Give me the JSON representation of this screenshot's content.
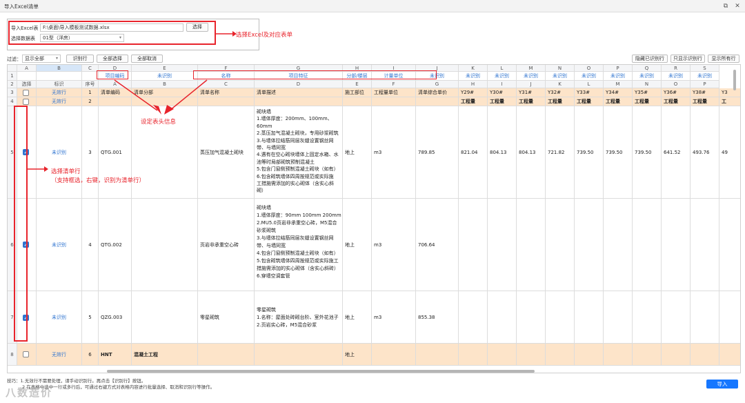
{
  "window": {
    "title": "导入Excel清单"
  },
  "file_panel": {
    "excel_label": "导入Excel表",
    "excel_path": "F:\\桌面\\导入模板测试数据.xlsx",
    "select_button": "选择",
    "sheet_label": "选择数据表",
    "sheet_value": "01型（洋房）"
  },
  "annotations": {
    "file_note": "选择Excel及对应表单",
    "header_note": "设定表头信息",
    "row_note_1": "选择清单行",
    "row_note_2": "（支持框选，右键，识别为清单行）"
  },
  "toolbar": {
    "filter_label": "过滤：",
    "filter_value": "显示全部",
    "btn_identify": "识别行",
    "btn_select_all": "全部选择",
    "btn_deselect_all": "全部取消",
    "btn_hide_identified": "隐藏已识别行",
    "btn_show_identified_only": "只显示识别行",
    "btn_show_all": "显示所有行"
  },
  "grid": {
    "letter_row": [
      "",
      "A",
      "B",
      "C",
      "D",
      "E",
      "F",
      "G",
      "H",
      "I",
      "J",
      "K",
      "L",
      "M",
      "N",
      "O",
      "P",
      "Q",
      "R",
      "S"
    ],
    "row1": [
      "1",
      "",
      "",
      "",
      "项目编码",
      "未识别",
      "名称",
      "项目特征",
      "分部/楼层",
      "计量单位",
      "未识别",
      "未识别",
      "未识别",
      "未识别",
      "未识别",
      "未识别",
      "未识别",
      "未识别",
      "未识别",
      "未识别"
    ],
    "row2": [
      "2",
      "选择",
      "标识",
      "序号",
      "A",
      "B",
      "C",
      "D",
      "E",
      "F",
      "G",
      "H",
      "I",
      "J",
      "K",
      "L",
      "M",
      "N",
      "O",
      "P"
    ],
    "row3": [
      "3",
      "",
      "无效行",
      "1",
      "清单编码",
      "清单分部",
      "清单名称",
      "清单描述",
      "施工部位",
      "工程量单位",
      "清单综合单价",
      "Y29#",
      "Y30#",
      "Y31#",
      "Y32#",
      "Y33#",
      "Y34#",
      "Y35#",
      "Y36#",
      "Y38#",
      "Y3"
    ],
    "row4": [
      "4",
      "",
      "无效行",
      "2",
      "",
      "",
      "",
      "",
      "",
      "",
      "",
      "工程量",
      "工程量",
      "工程量",
      "工程量",
      "工程量",
      "工程量",
      "工程量",
      "工程量",
      "工程量",
      "工"
    ],
    "row5": {
      "num": "5",
      "flag": "未识别",
      "seq": "3",
      "code": "QTG.001",
      "part": "",
      "name": "蒸压加气混凝土砌块",
      "location": "地上",
      "unit": "m3",
      "price": "789.85",
      "desc": [
        "砌块墙",
        "1.墙体厚度：200mm、100mm、",
        "60mm",
        "2.蒸压加气混凝土砌块，专用砂浆砌筑",
        "3.与墙体拉结筋同层灰缝设置钢丝网",
        "带、与墙同宽",
        "4.遇有在空心砌块墙体上固定水箱、水",
        "池等时局部砌筑预制混凝土",
        "5.包含门窗侧预制混凝土砌块（如有）",
        "6.包含砌筑墙体四周按规范或实际施",
        "工措施需添加的实心砌体（含实心斜",
        "砌）"
      ],
      "qty": [
        "821.04",
        "804.13",
        "804.13",
        "721.82",
        "739.50",
        "739.50",
        "739.50",
        "641.52",
        "493.76",
        "49"
      ]
    },
    "row6": {
      "num": "6",
      "flag": "未识别",
      "seq": "4",
      "code": "QTG.002",
      "part": "",
      "name": "页岩非承重空心砖",
      "location": "地上",
      "unit": "m3",
      "price": "706.64",
      "desc": [
        "砌块墙",
        "1.墙体厚度：90mm 100mm 200mm",
        "2.MU5.0页岩非承重空心砖，M5混合",
        "砂浆砌筑",
        "3.与墙体拉结筋同层灰缝设置钢丝网",
        "带、与墙同宽",
        "4.包含门窗侧预制混凝土砌块（如有）",
        "5.包含砌筑墙体四周按规范或实际施工",
        "措施需添加的实心砌体（含实心斜砖）",
        "6.穿墙空调套管"
      ]
    },
    "row7": {
      "num": "7",
      "flag": "未识别",
      "seq": "5",
      "code": "QZG.003",
      "part": "",
      "name": "零星砌筑",
      "location": "地上",
      "unit": "m3",
      "price": "855.38",
      "desc": [
        "零星砌筑",
        "1.名称：屋面处砖砌台阶、室外花池子",
        "2.页岩实心砖，M5混合砂浆"
      ]
    },
    "row8": {
      "num": "8",
      "flag": "无效行",
      "seq": "6",
      "code": "HNT",
      "part": "混凝土工程",
      "location": "地上"
    }
  },
  "footer": {
    "hint_1": "技巧：1.无效行不需要处理，请手动识别行。再点击【识别行】按钮。",
    "hint_2": "2.在表格中选中一行或多行后，可通过右键方式对表格内容进行批量选择、取消和识别行等操作。",
    "import_button": "导入",
    "watermark": "八数造价"
  },
  "colors": {
    "accent": "#2f74d0",
    "annotation_red": "#e8232b",
    "invalid_row": "#fde4c9",
    "import_button": "#1677ff"
  }
}
